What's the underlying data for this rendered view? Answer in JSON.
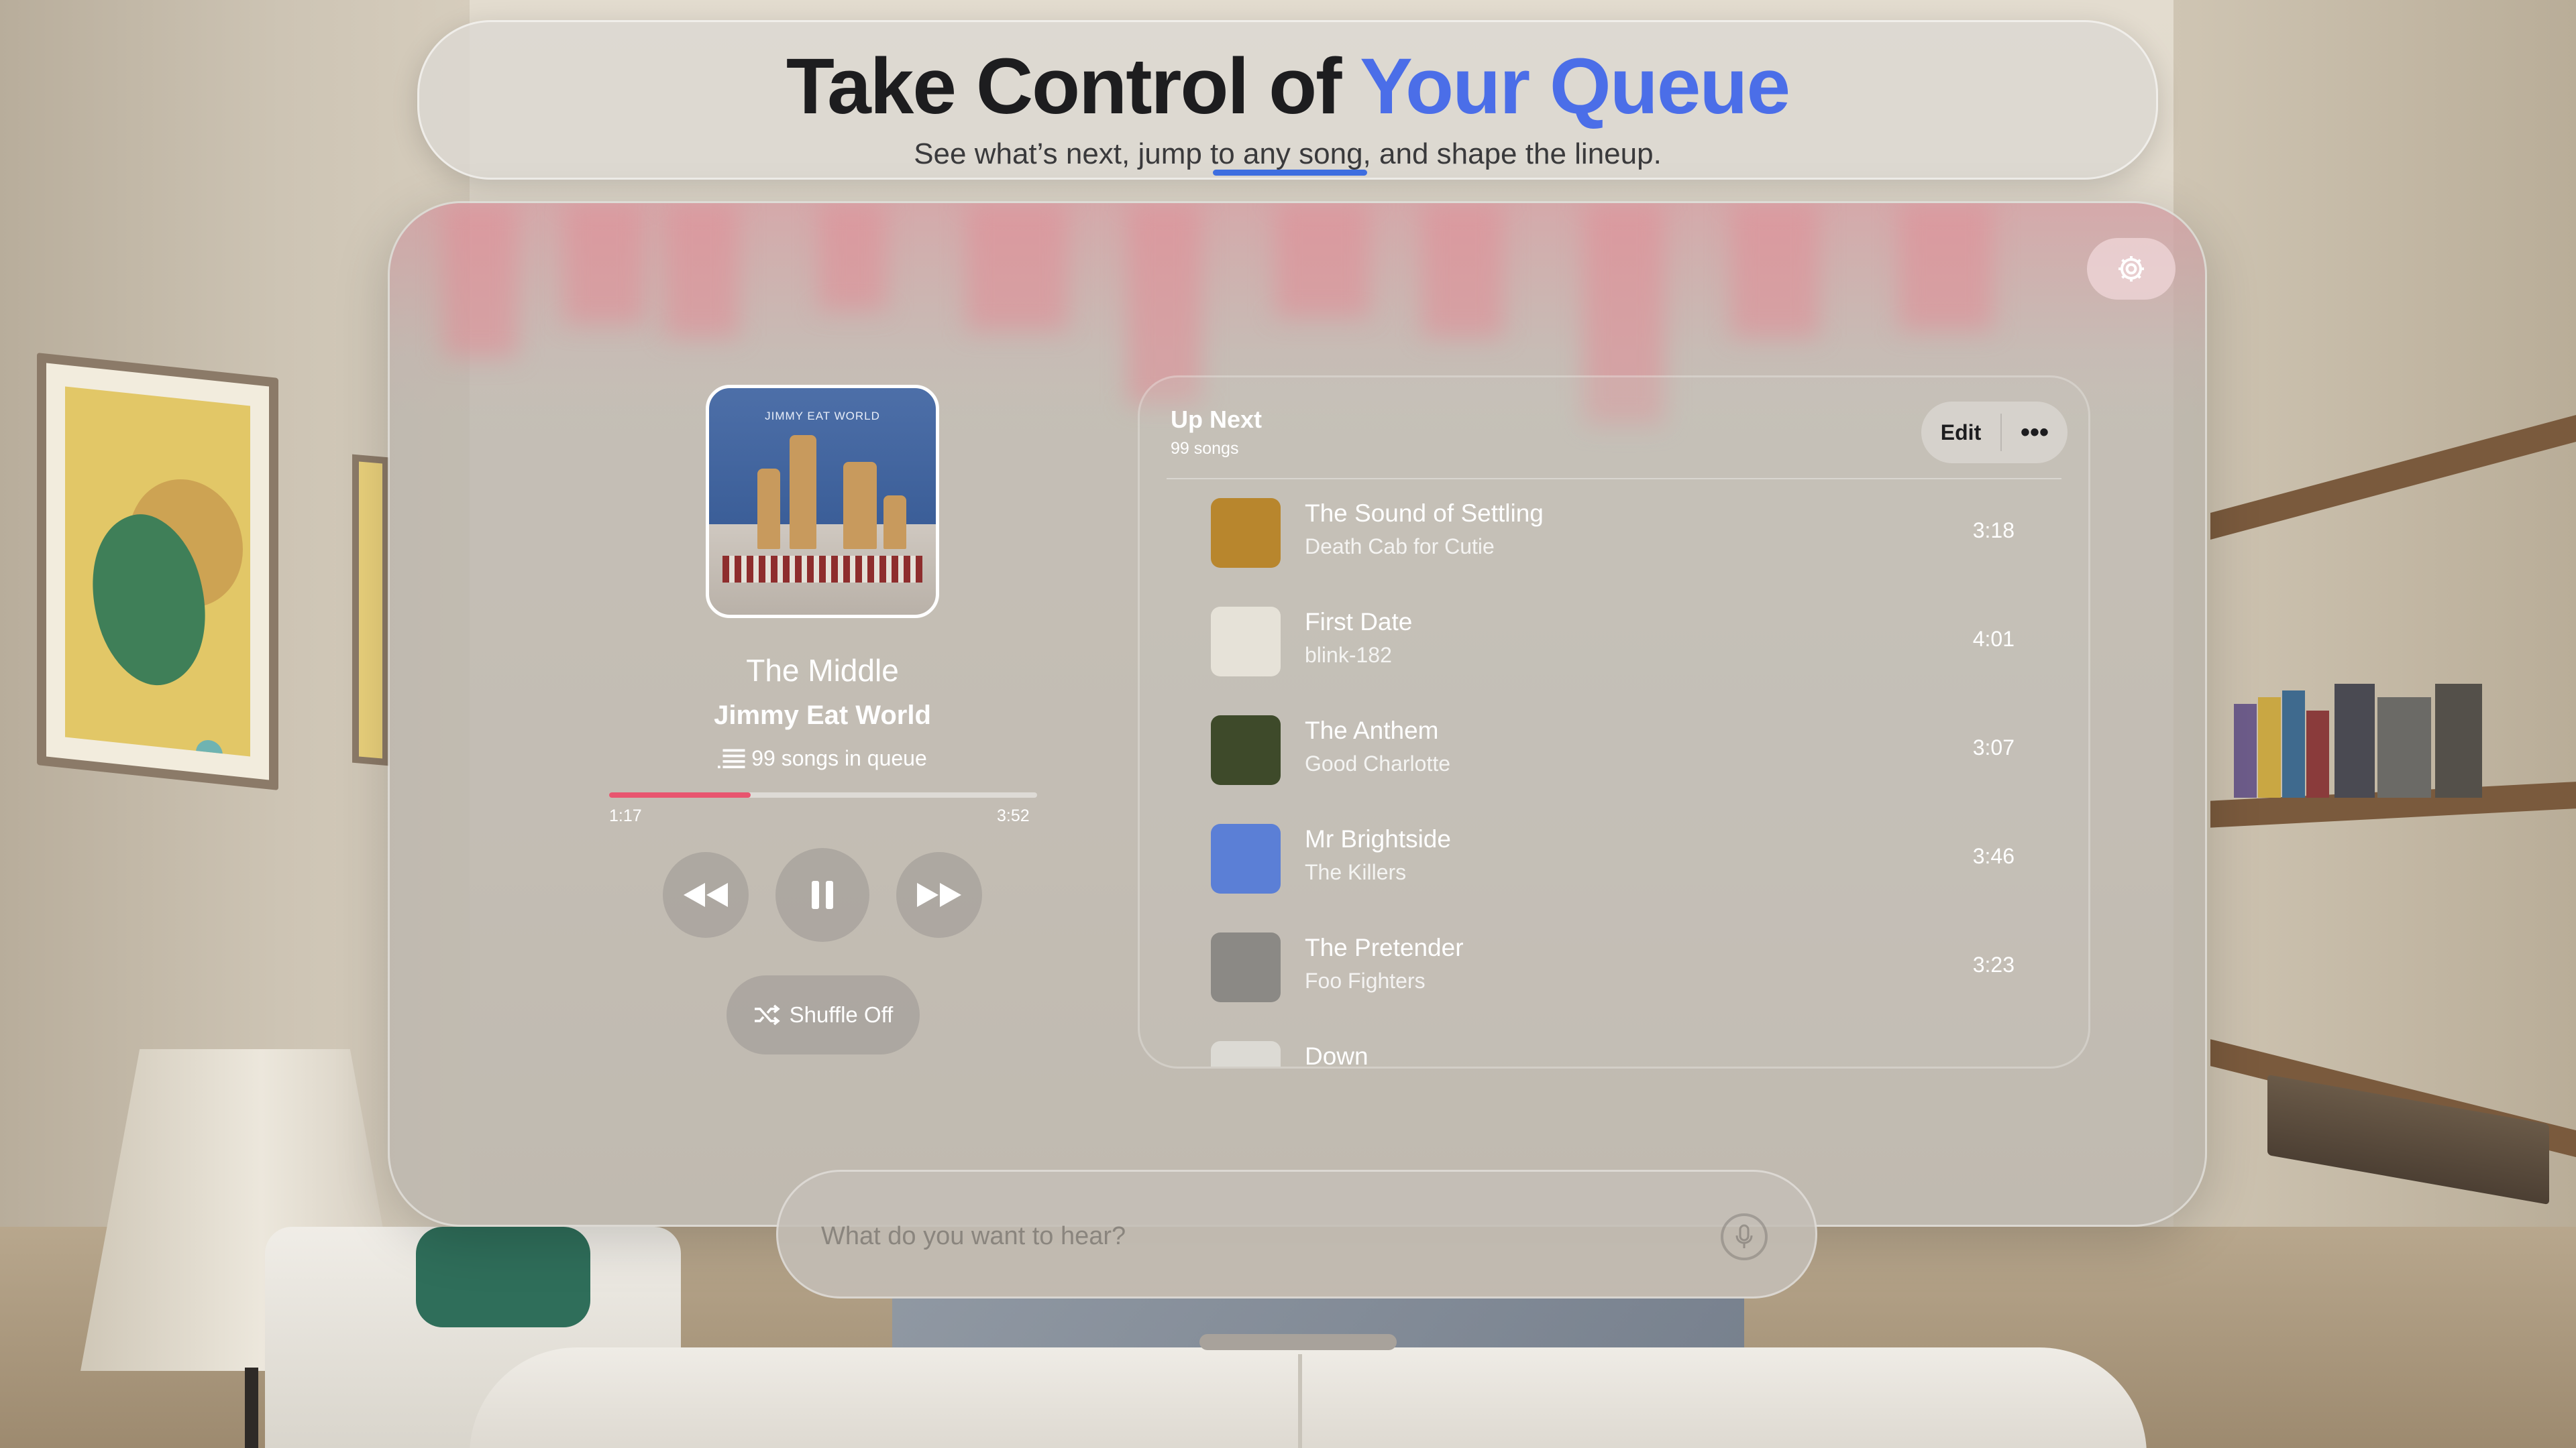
{
  "banner": {
    "title_main": "Take Control of ",
    "title_accent": "Your Queue",
    "subtitle": "See what’s next, jump to any song, and shape the lineup."
  },
  "now_playing": {
    "album_text": "JIMMY EAT WORLD",
    "title": "The Middle",
    "artist": "Jimmy Eat World",
    "queue_label": "99 songs in queue",
    "elapsed": "1:17",
    "duration": "3:52",
    "progress": 0.33,
    "shuffle_label": "Shuffle Off"
  },
  "up_next": {
    "title": "Up Next",
    "count": "99 songs",
    "edit_label": "Edit",
    "more_label": "•••",
    "songs": [
      {
        "title": "The Sound of Settling",
        "artist": "Death Cab for Cutie",
        "duration": "3:18",
        "art": "#b8862d"
      },
      {
        "title": "First Date",
        "artist": "blink-182",
        "duration": "4:01",
        "art": "#e6e2d8"
      },
      {
        "title": "The Anthem",
        "artist": "Good Charlotte",
        "duration": "3:07",
        "art": "#3e4a2a"
      },
      {
        "title": "Mr Brightside",
        "artist": "The Killers",
        "duration": "3:46",
        "art": "#5b7fd6"
      },
      {
        "title": "The Pretender",
        "artist": "Foo Fighters",
        "duration": "3:23",
        "art": "#8b8985"
      },
      {
        "title": "Down",
        "artist": "",
        "duration": "",
        "art": "#dcdad4"
      }
    ]
  },
  "search": {
    "placeholder": "What do you want to hear?"
  },
  "colors": {
    "accent": "#4b6ee8",
    "progress": "#e8556f"
  }
}
